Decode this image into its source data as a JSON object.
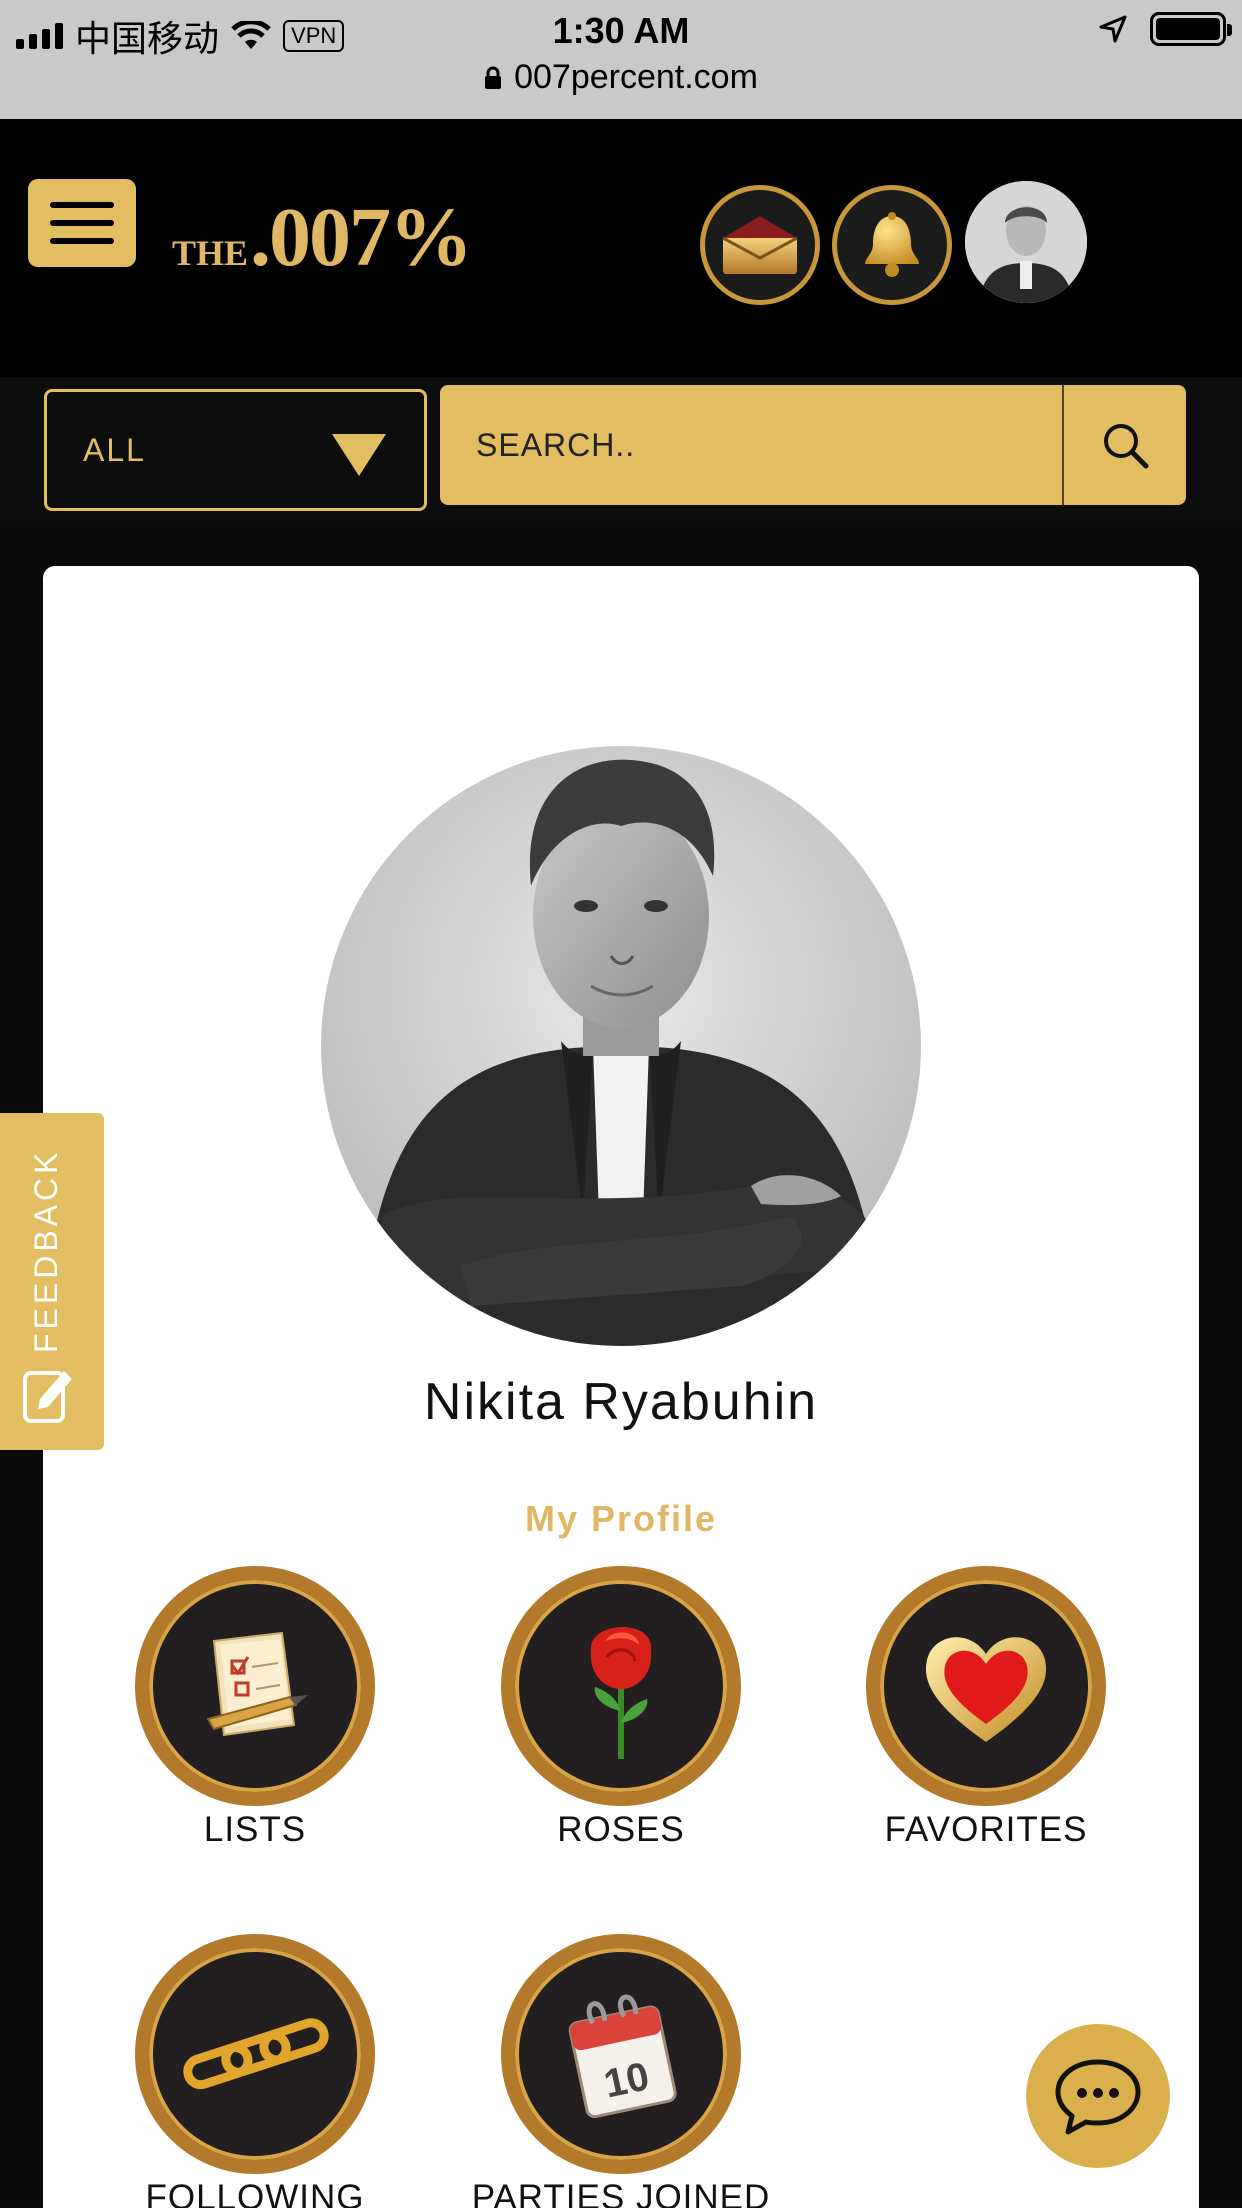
{
  "status_bar": {
    "carrier": "中国移动",
    "vpn": "VPN",
    "time": "1:30 AM"
  },
  "browser": {
    "url": "007percent.com"
  },
  "header": {
    "logo_prefix": "THE",
    "logo_main": ".007%"
  },
  "filter": {
    "selected": "ALL"
  },
  "search": {
    "placeholder": "SEARCH.."
  },
  "profile": {
    "name": "Nikita Ryabuhin",
    "section_title": "My Profile",
    "tiles": [
      {
        "label": "LISTS",
        "icon": "list-icon"
      },
      {
        "label": "ROSES",
        "icon": "rose-icon"
      },
      {
        "label": "FAVORITES",
        "icon": "heart-icon"
      },
      {
        "label": "FOLLOWING",
        "icon": "chain-link-icon"
      },
      {
        "label": "PARTIES JOINED",
        "icon": "calendar-icon",
        "calendar_day": "10"
      }
    ]
  },
  "feedback": {
    "label": "FEEDBACK"
  },
  "colors": {
    "gold": "#e3bd62",
    "ring_brown": "#b27a2a",
    "background": "#0a0a0a"
  }
}
